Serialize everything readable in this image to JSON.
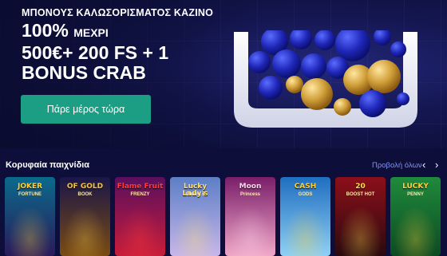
{
  "hero": {
    "kicker": "ΜΠΟΝΟΥΣ ΚΑΛΩΣΟΡΙΣΜΑΤΟΣ ΚΑΖΙΝΟ",
    "line1_big": "100%",
    "line1_small": "ΜΕΧΡΙ",
    "line2": "500€+ 200 FS + 1",
    "line3": "BONUS CRAB",
    "cta_label": "Πάρε μέρος τώρα"
  },
  "games_section": {
    "title": "Κορυφαία παιχνίδια",
    "view_all": "Προβολή όλων",
    "prev_icon": "‹",
    "next_icon": "›",
    "games": [
      {
        "title": "JOKER",
        "subtitle": "FORTUNE",
        "bg1": "#0b6a8c",
        "bg2": "#2a1a5a",
        "accent": "#ffd23a"
      },
      {
        "title": "OF GOLD",
        "subtitle": "BOOK",
        "bg1": "#1a1648",
        "bg2": "#7a4b12",
        "accent": "#f5c542"
      },
      {
        "title": "Flame Fruit",
        "subtitle": "FRENZY",
        "bg1": "#5a0f5e",
        "bg2": "#c81d3a",
        "accent": "#ff3b3b"
      },
      {
        "title": "Lucky Lady's",
        "subtitle": "Charm 6",
        "bg1": "#5c7fc6",
        "bg2": "#c8b6ea",
        "accent": "#ffe070"
      },
      {
        "title": "Moon",
        "subtitle": "Princess",
        "bg1": "#7a1e6a",
        "bg2": "#f0a8c8",
        "accent": "#ffd6ec"
      },
      {
        "title": "CASH",
        "subtitle": "GODS",
        "bg1": "#1f6ec0",
        "bg2": "#8fd0f5",
        "accent": "#ffd23a"
      },
      {
        "title": "20",
        "subtitle": "BOOST HOT",
        "bg1": "#8c0f1a",
        "bg2": "#2a0a0e",
        "accent": "#ffdf4a"
      },
      {
        "title": "LUCKY",
        "subtitle": "PENNY",
        "bg1": "#1f8a3c",
        "bg2": "#0d4a22",
        "accent": "#ffd23a"
      }
    ]
  }
}
